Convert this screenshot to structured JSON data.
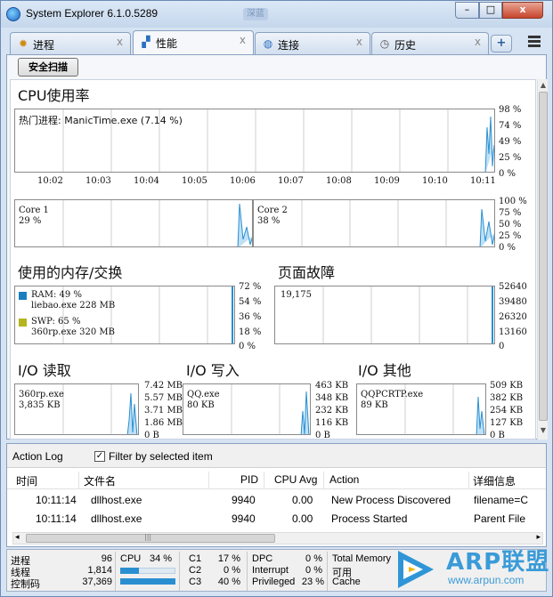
{
  "window": {
    "title": "System Explorer 6.1.0.5289",
    "title_extra": "深蓝",
    "minimize": "–",
    "maximize": "□",
    "close": "x"
  },
  "tabs": [
    {
      "label": "进程",
      "icon": "gear-icon",
      "close": "x"
    },
    {
      "label": "性能",
      "icon": "chart-icon",
      "close": "x"
    },
    {
      "label": "连接",
      "icon": "globe-icon",
      "close": "x"
    },
    {
      "label": "历史",
      "icon": "clock-icon",
      "close": "x"
    }
  ],
  "tab_add": "+",
  "toolbar": {
    "safe_scan": "安全扫描"
  },
  "cpu": {
    "title": "CPU使用率",
    "hot_process_label": "热门进程",
    "hot_process_value": ": ManicTime.exe (7.14 %)",
    "scale": [
      "98 %",
      "74 %",
      "49 %",
      "25 %",
      "0 %"
    ],
    "times": [
      "10:02",
      "10:03",
      "10:04",
      "10:05",
      "10:06",
      "10:07",
      "10:08",
      "10:09",
      "10:10",
      "10:11"
    ]
  },
  "cores": {
    "core1_name": "Core 1",
    "core1_value": "29 %",
    "core2_name": "Core 2",
    "core2_value": "38 %",
    "scale": [
      "100 %",
      "75 %",
      "50 %",
      "25 %",
      "0 %"
    ]
  },
  "memory": {
    "title": "使用的内存/交换",
    "ram_label": "RAM: 49 %",
    "ram_proc": "liebao.exe 228 MB",
    "swp_label": "SWP: 65 %",
    "swp_proc": "360rp.exe 320 MB",
    "scale": [
      "72 %",
      "54 %",
      "36 %",
      "18 %",
      "0 %"
    ],
    "ram_color": "#1a7fbf",
    "swp_color": "#b5b51f"
  },
  "pagefaults": {
    "title": "页面故障",
    "value": "19,175",
    "scale": [
      "52640",
      "39480",
      "26320",
      "13160",
      "0"
    ]
  },
  "io_read": {
    "title": "I/O 读取",
    "proc": "360rp.exe",
    "value": "3,835 KB",
    "scale": [
      "7.42 MB",
      "5.57 MB",
      "3.71 MB",
      "1.86 MB",
      "0 B"
    ]
  },
  "io_write": {
    "title": "I/O 写入",
    "proc": "QQ.exe",
    "value": "80 KB",
    "scale": [
      "463 KB",
      "348 KB",
      "232 KB",
      "116 KB",
      "0 B"
    ]
  },
  "io_other": {
    "title": "I/O 其他",
    "proc": "QQPCRTP.exe",
    "value": "89 KB",
    "scale": [
      "509 KB",
      "382 KB",
      "254 KB",
      "127 KB",
      "0 B"
    ]
  },
  "action_log": {
    "title": "Action Log",
    "filter_label": "Filter by selected item",
    "filter_checked": "✓",
    "columns": [
      "时间",
      "文件名",
      "PID",
      "CPU Avg",
      "Action",
      "详细信息"
    ],
    "rows": [
      {
        "time": "10:11:14",
        "file": "dllhost.exe",
        "pid": "9940",
        "cpu": "0.00",
        "action": "New Process Discovered",
        "detail": "filename=C"
      },
      {
        "time": "10:11:14",
        "file": "dllhost.exe",
        "pid": "9940",
        "cpu": "0.00",
        "action": "Process Started",
        "detail": "Parent File"
      }
    ],
    "scroll_left": "◂",
    "scroll_right": "▸",
    "scroll_grip": "|||"
  },
  "status": {
    "processes_label": "进程",
    "processes_value": "96",
    "threads_label": "线程",
    "threads_value": "1,814",
    "handles_label": "控制码",
    "handles_value": "37,369",
    "cpu_label": "CPU",
    "cpu_value": "34 %",
    "c1_label": "C1",
    "c1_value": "17 %",
    "c2_label": "C2",
    "c2_value": "0 %",
    "c3_label": "C3",
    "c3_value": "40 %",
    "dpc_label": "DPC",
    "dpc_value": "0 %",
    "interrupt_label": "Interrupt",
    "interrupt_value": "0 %",
    "privileged_label": "Privileged",
    "privileged_value": "23 %",
    "mem_label": "Total Memory",
    "avail_label": "可用",
    "cache_label": "Cache",
    "cpu_level": 0.34
  },
  "watermark": {
    "brand": "ARP联盟",
    "url": "www.arpun.com"
  }
}
